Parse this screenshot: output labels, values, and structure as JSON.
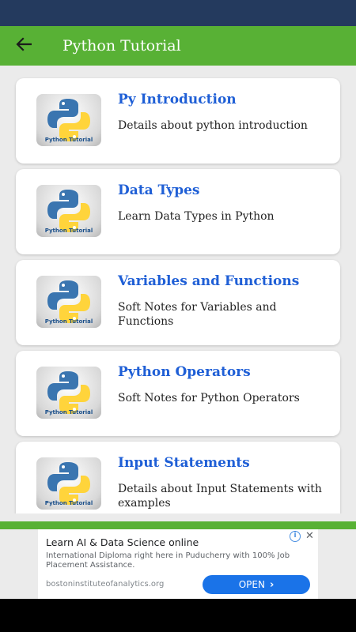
{
  "app_bar": {
    "title": "Python Tutorial",
    "back_icon": "arrow-left-icon",
    "background": "#58b135"
  },
  "status_bar": {
    "background": "#243a5e"
  },
  "logo_caption": "Python Tutorial",
  "items": [
    {
      "title": "Py Introduction",
      "description": "Details about python introduction"
    },
    {
      "title": "Data Types",
      "description": "Learn Data Types in Python"
    },
    {
      "title": "Variables and Functions",
      "description": "Soft Notes for Variables and Functions"
    },
    {
      "title": "Python Operators",
      "description": "Soft Notes for Python Operators"
    },
    {
      "title": "Input Statements",
      "description": "Details about Input Statements with examples"
    }
  ],
  "colors": {
    "accent_green": "#58b135",
    "title_blue": "#1f5fd6",
    "python_blue": "#3a75b0",
    "python_yellow": "#ffd43b"
  },
  "ad": {
    "title": "Learn AI & Data Science online",
    "description": "International Diploma right here in Puducherry with 100% Job Placement Assistance.",
    "url": "bostoninstituteofanalytics.org",
    "open_label": "OPEN",
    "info_label": "i",
    "close_label": "✕",
    "button_color": "#1a73e8"
  }
}
